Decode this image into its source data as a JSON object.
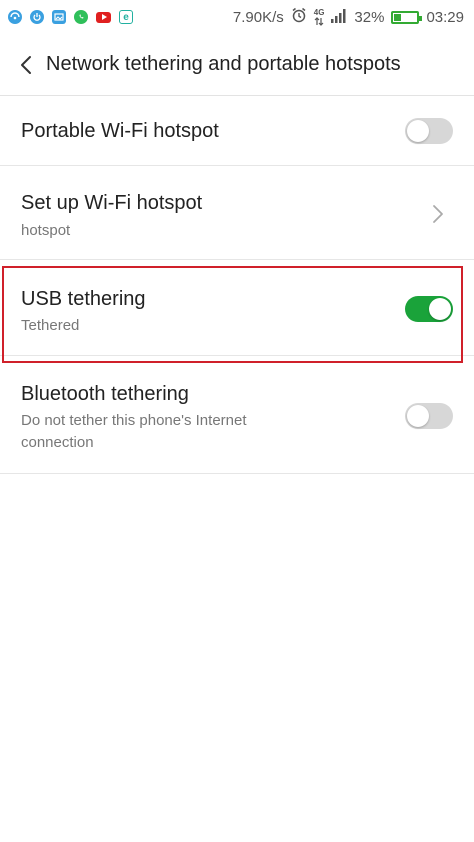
{
  "status_bar": {
    "apps": [
      {
        "icon": "wifi-share-icon",
        "color": "#3aa0e0"
      },
      {
        "icon": "power-icon",
        "color": "#3aa0e0"
      },
      {
        "icon": "gallery-icon",
        "color": "#3aa0e0"
      },
      {
        "icon": "whatsapp-icon",
        "color": "#2fbf5a"
      },
      {
        "icon": "youtube-icon",
        "color": "#e02020"
      },
      {
        "icon": "e-browser-icon",
        "color": "#22b0a0"
      }
    ],
    "network_speed": "7.90K/s",
    "network_type": "4G",
    "battery_percent": "32%",
    "battery_level": 0.32,
    "time": "03:29"
  },
  "header": {
    "title": "Network tethering and portable hotspots"
  },
  "rows": {
    "portable_hotspot": {
      "title": "Portable Wi-Fi hotspot",
      "enabled": false
    },
    "setup_hotspot": {
      "title": "Set up Wi-Fi hotspot",
      "subtitle": "hotspot"
    },
    "usb_tethering": {
      "title": "USB tethering",
      "subtitle": "Tethered",
      "enabled": true
    },
    "bluetooth_tethering": {
      "title": "Bluetooth tethering",
      "subtitle": "Do not tether this phone's Internet connection",
      "enabled": false
    }
  },
  "colors": {
    "toggle_on": "#1aa33a",
    "toggle_off": "#d7d7d7",
    "highlight": "#d0202a"
  }
}
